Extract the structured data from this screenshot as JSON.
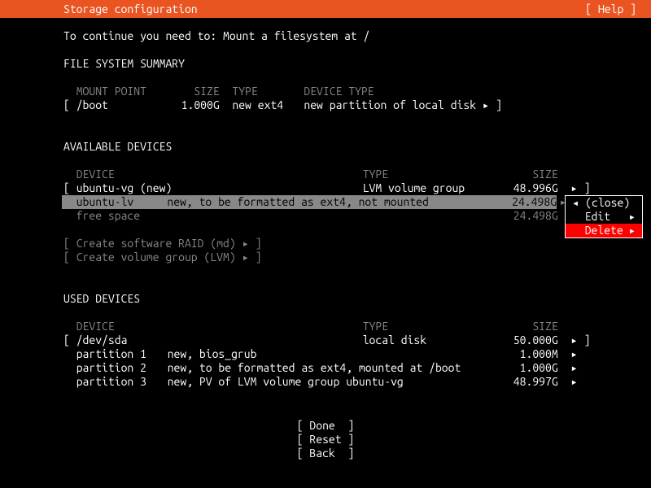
{
  "header": {
    "title": "Storage configuration",
    "help": "[ Help ]"
  },
  "instruction": "To continue you need to: Mount a filesystem at /",
  "fs_summary": {
    "title": "FILE SYSTEM SUMMARY",
    "headers": {
      "mount": "MOUNT POINT",
      "size": "SIZE",
      "type": "TYPE",
      "dtype": "DEVICE TYPE"
    },
    "row": {
      "mount": "/boot",
      "size": "1.000G",
      "type": "new ext4",
      "dtype": "new partition of local disk"
    }
  },
  "available": {
    "title": "AVAILABLE DEVICES",
    "headers": {
      "device": "DEVICE",
      "type": "TYPE",
      "size": "SIZE"
    },
    "vg": {
      "name": "ubuntu-vg (new)",
      "type": "LVM volume group",
      "size": "48.996G"
    },
    "lv": {
      "name": "ubuntu-lv",
      "desc": "new, to be formatted as ext4, not mounted",
      "size": "24.498G"
    },
    "free": {
      "name": "free space",
      "size": "24.498G"
    },
    "raid": "Create software RAID (md)",
    "lvm": "Create volume group (LVM)"
  },
  "popup": {
    "close": "(close)",
    "edit": "Edit",
    "delete": "Delete"
  },
  "used": {
    "title": "USED DEVICES",
    "headers": {
      "device": "DEVICE",
      "type": "TYPE",
      "size": "SIZE"
    },
    "disk": {
      "name": "/dev/sda",
      "type": "local disk",
      "size": "50.000G"
    },
    "p1": {
      "name": "partition 1",
      "desc": "new, bios_grub",
      "size": "1.000M"
    },
    "p2": {
      "name": "partition 2",
      "desc": "new, to be formatted as ext4, mounted at /boot",
      "size": "1.000G"
    },
    "p3": {
      "name": "partition 3",
      "desc": "new, PV of LVM volume group ubuntu-vg",
      "size": "48.997G"
    }
  },
  "buttons": {
    "done": "Done",
    "reset": "Reset",
    "back": "Back"
  },
  "glyph": {
    "right": "▸",
    "left": "◂"
  }
}
